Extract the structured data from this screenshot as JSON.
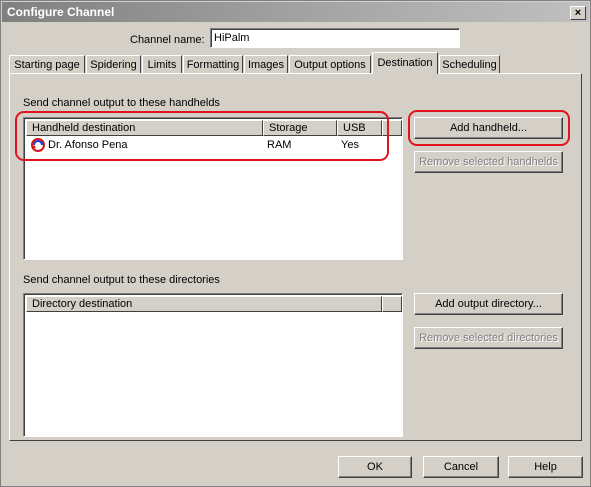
{
  "window": {
    "title": "Configure Channel",
    "close": "×"
  },
  "channel": {
    "label": "Channel name:",
    "value": "HiPalm"
  },
  "tabs": [
    {
      "label": "Starting page"
    },
    {
      "label": "Spidering"
    },
    {
      "label": "Limits"
    },
    {
      "label": "Formatting"
    },
    {
      "label": "Images"
    },
    {
      "label": "Output options"
    },
    {
      "label": "Destination",
      "active": true
    },
    {
      "label": "Scheduling"
    }
  ],
  "handhelds": {
    "section_label": "Send channel output to these handhelds",
    "columns": [
      "Handheld destination",
      "Storage",
      "USB"
    ],
    "rows": [
      {
        "icon": "hotsync-icon",
        "destination": "Dr. Afonso Pena",
        "storage": "RAM",
        "usb": "Yes"
      }
    ],
    "add_button": "Add handheld...",
    "remove_button": "Remove selected handhelds"
  },
  "directories": {
    "section_label": "Send channel output to these directories",
    "columns": [
      "Directory destination"
    ],
    "add_button": "Add output directory...",
    "remove_button": "Remove selected directories"
  },
  "footer": {
    "ok": "OK",
    "cancel": "Cancel",
    "help": "Help"
  },
  "colors": {
    "highlight": "#e0141e",
    "face": "#d4d0c8"
  }
}
